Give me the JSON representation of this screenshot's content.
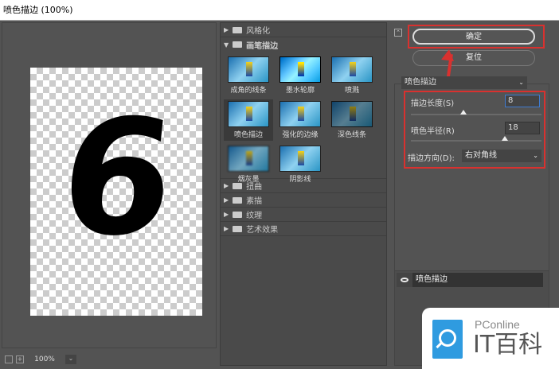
{
  "window": {
    "title": "喷色描边 (100%)"
  },
  "preview": {
    "glyph": "6",
    "zoom": "100%"
  },
  "filter_gallery": {
    "categories_top": [
      {
        "label": "风格化",
        "expanded": false
      },
      {
        "label": "画笔描边",
        "expanded": true
      }
    ],
    "thumbnails": [
      {
        "label": "成角的线条"
      },
      {
        "label": "墨水轮廓"
      },
      {
        "label": "喷溅"
      },
      {
        "label": "喷色描边",
        "selected": true
      },
      {
        "label": "强化的边缘"
      },
      {
        "label": "深色线条"
      },
      {
        "label": "烟灰墨"
      },
      {
        "label": "阴影线"
      }
    ],
    "categories_bottom": [
      {
        "label": "扭曲"
      },
      {
        "label": "素描"
      },
      {
        "label": "纹理"
      },
      {
        "label": "艺术效果"
      }
    ]
  },
  "buttons": {
    "ok": "确定",
    "reset": "复位"
  },
  "settings": {
    "filter_select": "喷色描边",
    "stroke_length_label": "描边长度(S)",
    "stroke_length": "8",
    "stroke_length_fraction": 0.4,
    "spray_radius_label": "喷色半径(R)",
    "spray_radius": "18",
    "spray_radius_fraction": 0.72,
    "direction_label": "描边方向(D):",
    "direction": "右对角线"
  },
  "layers": [
    {
      "name": "喷色描边",
      "visible": true
    }
  ],
  "watermark": {
    "brand": "PConline",
    "name": "IT百科"
  },
  "colors": {
    "highlight": "#d9312f",
    "accent": "#2f9be0"
  }
}
